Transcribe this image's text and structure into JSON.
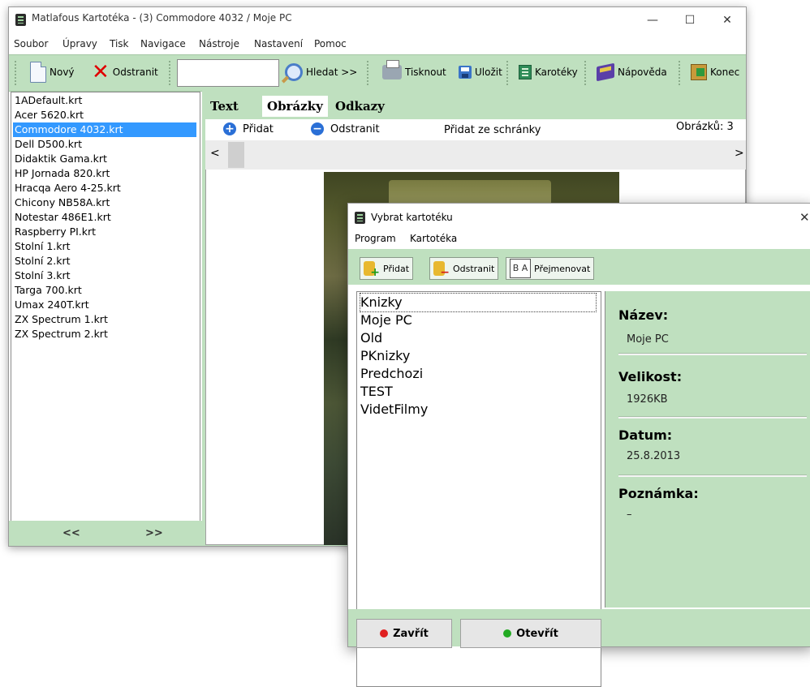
{
  "main_window": {
    "title": "Matlafous Kartotéka - (3) Commodore 4032 / Moje PC",
    "controls": {
      "minimize": "—",
      "maximize": "☐",
      "close": "✕"
    },
    "menu": [
      "Soubor",
      "Úpravy",
      "Tisk",
      "Navigace",
      "Nástroje",
      "Nastavení",
      "Pomoc"
    ],
    "toolbar": {
      "new_label": "Nový",
      "delete_label": "Odstranit",
      "search_value": "",
      "search_label": "Hledat >>",
      "print_label": "Tisknout",
      "save_label": "Uložit",
      "cards_label": "Karotéky",
      "help_label": "Nápověda",
      "exit_label": "Konec"
    },
    "files": [
      "1ADefault.krt",
      "Acer 5620.krt",
      "Commodore 4032.krt",
      "Dell D500.krt",
      "Didaktik Gama.krt",
      "HP Jornada 820.krt",
      "Hracqa Aero 4-25.krt",
      "Chicony NB58A.krt",
      "Notestar 486E1.krt",
      "Raspberry PI.krt",
      "Stolní 1.krt",
      "Stolní 2.krt",
      "Stolní 3.krt",
      "Targa 700.krt",
      "Umax 240T.krt",
      "ZX Spectrum 1.krt",
      "ZX Spectrum 2.krt"
    ],
    "selected_file": "Commodore 4032.krt",
    "nav": {
      "prev": "<<",
      "next": ">>"
    },
    "tabs": [
      "Text",
      "Obrázky",
      "Odkazy"
    ],
    "active_tab": "Obrázky",
    "image_bar": {
      "add": "Přidat",
      "remove": "Odstranit",
      "paste": "Přidat ze schránky",
      "count": "Obrázků: 3"
    },
    "scroll": {
      "left": "<",
      "right": ">"
    }
  },
  "dialog": {
    "title": "Vybrat kartotéku",
    "close": "✕",
    "menu": [
      "Program",
      "Kartotéka"
    ],
    "toolbar": {
      "add": "Přidat",
      "remove": "Odstranit",
      "rename": "Přejmenovat"
    },
    "items": [
      "Knizky",
      "Moje PC",
      "Old",
      "PKnizky",
      "Predchozi",
      "TEST",
      "VidetFilmy"
    ],
    "selected_item": "Knizky",
    "info": {
      "name_label": "Název:",
      "name_value": "Moje PC",
      "size_label": "Velikost:",
      "size_value": "1926KB",
      "date_label": "Datum:",
      "date_value": "25.8.2013",
      "note_label": "Poznámka:",
      "note_value": "–"
    },
    "footer": {
      "close": "Zavřít",
      "open": "Otevřít"
    }
  },
  "colors": {
    "accent_green": "#bfe0bf",
    "selection": "#3399ff",
    "red": "#e02020",
    "green": "#22aa22"
  }
}
